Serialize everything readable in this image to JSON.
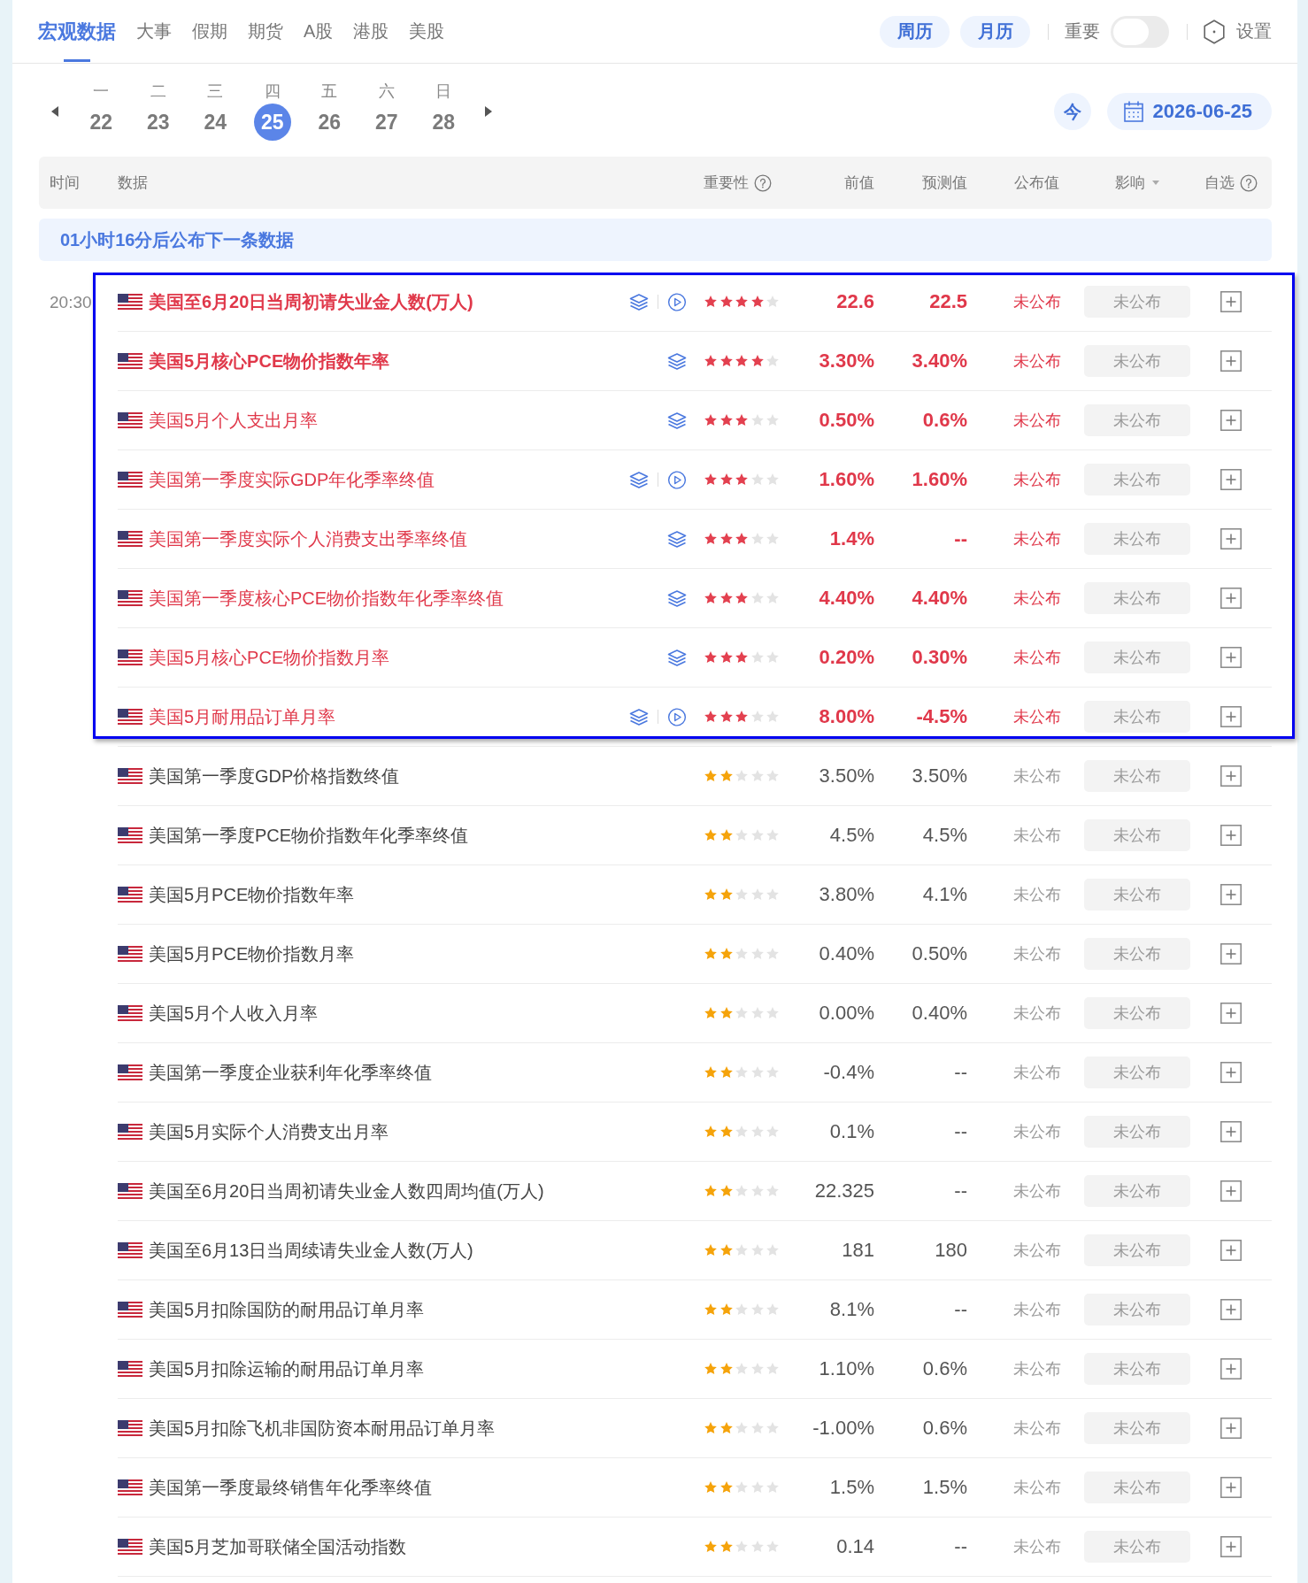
{
  "nav": {
    "tabs": [
      {
        "label": "宏观数据",
        "selected": true
      },
      {
        "label": "大事",
        "selected": false
      },
      {
        "label": "假期",
        "selected": false
      },
      {
        "label": "期货",
        "selected": false
      },
      {
        "label": "A股",
        "selected": false
      },
      {
        "label": "港股",
        "selected": false
      },
      {
        "label": "美股",
        "selected": false
      }
    ],
    "view_buttons": [
      {
        "label": "周历"
      },
      {
        "label": "月历"
      }
    ],
    "important_filter": {
      "label": "重要",
      "on": false
    },
    "settings": {
      "label": "设置"
    }
  },
  "week": {
    "days": [
      {
        "weekday": "一",
        "date": "22",
        "selected": false
      },
      {
        "weekday": "二",
        "date": "23",
        "selected": false
      },
      {
        "weekday": "三",
        "date": "24",
        "selected": false
      },
      {
        "weekday": "四",
        "date": "25",
        "selected": true
      },
      {
        "weekday": "五",
        "date": "26",
        "selected": false
      },
      {
        "weekday": "六",
        "date": "27",
        "selected": false
      },
      {
        "weekday": "日",
        "date": "28",
        "selected": false
      }
    ],
    "today_button": "今",
    "date_picker": "2026-06-25"
  },
  "table": {
    "columns": [
      {
        "label": "时间",
        "kind": "plain"
      },
      {
        "label": "数据",
        "kind": "plain"
      },
      {
        "label": "重要性",
        "kind": "help"
      },
      {
        "label": "前值",
        "kind": "plain"
      },
      {
        "label": "预测值",
        "kind": "plain"
      },
      {
        "label": "公布值",
        "kind": "plain"
      },
      {
        "label": "影响",
        "kind": "dropdown"
      },
      {
        "label": "自选",
        "kind": "help"
      }
    ],
    "notice": "01小时16分后公布下一条数据",
    "slots": [
      {
        "time": "20:30",
        "groups": [
          {
            "highlighted": true,
            "rows": [
              {
                "name": "美国至6月20日当周初请失业金人数(万人)",
                "stars": 4,
                "layers": true,
                "play": true,
                "previous": "22.6",
                "forecast": "22.5",
                "actual": "未公布",
                "impact": "未公布"
              },
              {
                "name": "美国5月核心PCE物价指数年率",
                "stars": 4,
                "layers": true,
                "play": false,
                "previous": "3.30%",
                "forecast": "3.40%",
                "actual": "未公布",
                "impact": "未公布"
              },
              {
                "name": "美国5月个人支出月率",
                "stars": 3,
                "layers": true,
                "play": false,
                "previous": "0.50%",
                "forecast": "0.6%",
                "actual": "未公布",
                "impact": "未公布"
              },
              {
                "name": "美国第一季度实际GDP年化季率终值",
                "stars": 3,
                "layers": true,
                "play": true,
                "previous": "1.60%",
                "forecast": "1.60%",
                "actual": "未公布",
                "impact": "未公布"
              },
              {
                "name": "美国第一季度实际个人消费支出季率终值",
                "stars": 3,
                "layers": true,
                "play": false,
                "previous": "1.4%",
                "forecast": "--",
                "actual": "未公布",
                "impact": "未公布"
              },
              {
                "name": "美国第一季度核心PCE物价指数年化季率终值",
                "stars": 3,
                "layers": true,
                "play": false,
                "previous": "4.40%",
                "forecast": "4.40%",
                "actual": "未公布",
                "impact": "未公布"
              },
              {
                "name": "美国5月核心PCE物价指数月率",
                "stars": 3,
                "layers": true,
                "play": false,
                "previous": "0.20%",
                "forecast": "0.30%",
                "actual": "未公布",
                "impact": "未公布"
              },
              {
                "name": "美国5月耐用品订单月率",
                "stars": 3,
                "layers": true,
                "play": true,
                "previous": "8.00%",
                "forecast": "-4.5%",
                "actual": "未公布",
                "impact": "未公布"
              }
            ]
          },
          {
            "highlighted": false,
            "rows": [
              {
                "name": "美国第一季度GDP价格指数终值",
                "stars": 2,
                "layers": false,
                "play": false,
                "previous": "3.50%",
                "forecast": "3.50%",
                "actual": "未公布",
                "impact": "未公布"
              },
              {
                "name": "美国第一季度PCE物价指数年化季率终值",
                "stars": 2,
                "layers": false,
                "play": false,
                "previous": "4.5%",
                "forecast": "4.5%",
                "actual": "未公布",
                "impact": "未公布"
              },
              {
                "name": "美国5月PCE物价指数年率",
                "stars": 2,
                "layers": false,
                "play": false,
                "previous": "3.80%",
                "forecast": "4.1%",
                "actual": "未公布",
                "impact": "未公布"
              },
              {
                "name": "美国5月PCE物价指数月率",
                "stars": 2,
                "layers": false,
                "play": false,
                "previous": "0.40%",
                "forecast": "0.50%",
                "actual": "未公布",
                "impact": "未公布"
              },
              {
                "name": "美国5月个人收入月率",
                "stars": 2,
                "layers": false,
                "play": false,
                "previous": "0.00%",
                "forecast": "0.40%",
                "actual": "未公布",
                "impact": "未公布"
              },
              {
                "name": "美国第一季度企业获利年化季率终值",
                "stars": 2,
                "layers": false,
                "play": false,
                "previous": "-0.4%",
                "forecast": "--",
                "actual": "未公布",
                "impact": "未公布"
              },
              {
                "name": "美国5月实际个人消费支出月率",
                "stars": 2,
                "layers": false,
                "play": false,
                "previous": "0.1%",
                "forecast": "--",
                "actual": "未公布",
                "impact": "未公布"
              },
              {
                "name": "美国至6月20日当周初请失业金人数四周均值(万人)",
                "stars": 2,
                "layers": false,
                "play": false,
                "previous": "22.325",
                "forecast": "--",
                "actual": "未公布",
                "impact": "未公布"
              },
              {
                "name": "美国至6月13日当周续请失业金人数(万人)",
                "stars": 2,
                "layers": false,
                "play": false,
                "previous": "181",
                "forecast": "180",
                "actual": "未公布",
                "impact": "未公布"
              },
              {
                "name": "美国5月扣除国防的耐用品订单月率",
                "stars": 2,
                "layers": false,
                "play": false,
                "previous": "8.1%",
                "forecast": "--",
                "actual": "未公布",
                "impact": "未公布"
              },
              {
                "name": "美国5月扣除运输的耐用品订单月率",
                "stars": 2,
                "layers": false,
                "play": false,
                "previous": "1.10%",
                "forecast": "0.6%",
                "actual": "未公布",
                "impact": "未公布"
              },
              {
                "name": "美国5月扣除飞机非国防资本耐用品订单月率",
                "stars": 2,
                "layers": false,
                "play": false,
                "previous": "-1.00%",
                "forecast": "0.6%",
                "actual": "未公布",
                "impact": "未公布"
              },
              {
                "name": "美国第一季度最终销售年化季率终值",
                "stars": 2,
                "layers": false,
                "play": false,
                "previous": "1.5%",
                "forecast": "1.5%",
                "actual": "未公布",
                "impact": "未公布"
              },
              {
                "name": "美国5月芝加哥联储全国活动指数",
                "stars": 2,
                "layers": false,
                "play": false,
                "previous": "0.14",
                "forecast": "--",
                "actual": "未公布",
                "impact": "未公布"
              }
            ]
          }
        ]
      }
    ]
  }
}
